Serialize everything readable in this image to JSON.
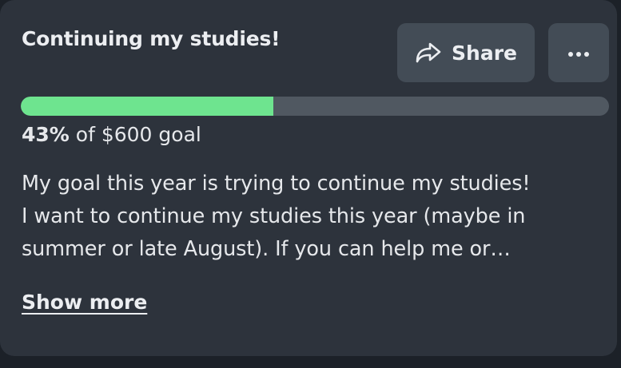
{
  "campaign": {
    "title": "Continuing my studies!",
    "progress_percent": 43,
    "progress_percent_label": "43%",
    "progress_suffix": "of $600 goal",
    "description_lines": [
      "My goal this year is trying to continue my studies!",
      "I want to continue my studies this year (maybe in",
      "summer or late August). If you can help me or…"
    ],
    "show_more_label": "Show more"
  },
  "actions": {
    "share_label": "Share",
    "share_icon": "share-arrow-icon",
    "more_icon": "ellipsis-icon"
  },
  "colors": {
    "card_background": "#2d333c",
    "button_background": "#434c56",
    "progress_fill": "#6ee48f",
    "progress_track": "#505861"
  }
}
